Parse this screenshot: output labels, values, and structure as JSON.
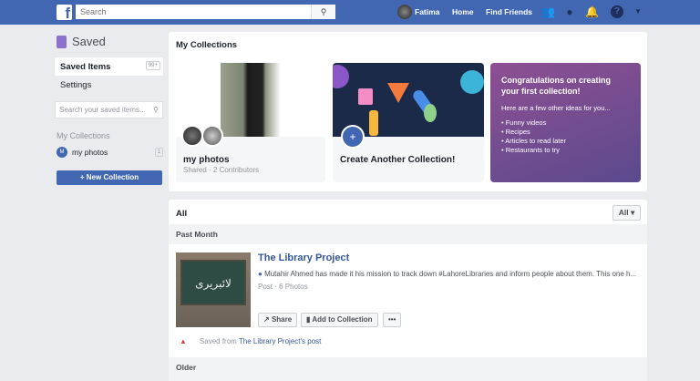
{
  "header": {
    "search_placeholder": "Search",
    "user": "Fatima",
    "home": "Home",
    "find_friends": "Find Friends"
  },
  "sidebar": {
    "title": "Saved",
    "saved_items": "Saved Items",
    "saved_badge": "99+",
    "settings": "Settings",
    "search_placeholder": "Search your saved items...",
    "my_collections": "My Collections",
    "collections": [
      {
        "initial": "M",
        "name": "my photos",
        "count": "1"
      }
    ],
    "new_collection": "New Collection"
  },
  "collections_panel": {
    "title": "My Collections",
    "cards": [
      {
        "title": "my photos",
        "sub": "Shared · 2 Contributors"
      },
      {
        "title": "Create Another Collection!",
        "plus": "+"
      }
    ],
    "promo": {
      "title": "Congratulations on creating your first collection!",
      "intro": "Here are a few other ideas for you...",
      "ideas": [
        "• Funny videos",
        "• Recipes",
        "• Articles to read later",
        "• Restaurants to try"
      ]
    }
  },
  "items_panel": {
    "header": "All",
    "filter": "All ▾",
    "sections": [
      "Past Month",
      "Older"
    ],
    "item": {
      "thumb_text": "لائبریری",
      "title": "The Library Project",
      "desc": "Mutahir Ahmed has made it his mission to track down #LahoreLibraries and inform people about them. This one h...",
      "meta": "Post · 6 Photos",
      "share": "Share",
      "add": "Add to Collection",
      "more": "•••",
      "saved_from": "Saved from",
      "saved_source": "The Library Project's post"
    }
  }
}
